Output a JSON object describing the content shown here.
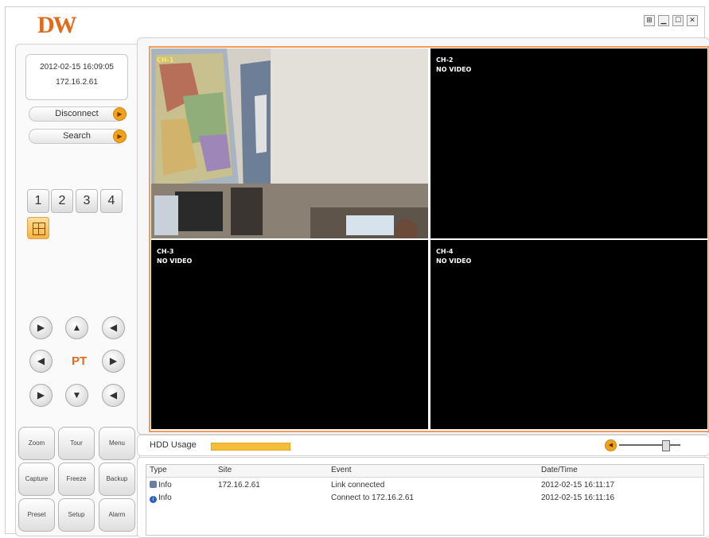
{
  "app": {
    "logo_text": "DW",
    "window_buttons": [
      {
        "name": "compact",
        "glyph": "⊞"
      },
      {
        "name": "minimize",
        "glyph": "▁"
      },
      {
        "name": "maximize",
        "glyph": "☐"
      },
      {
        "name": "close",
        "glyph": "✕"
      }
    ]
  },
  "status": {
    "datetime": "2012-02-15 16:09:05",
    "ip": "172.16.2.61"
  },
  "buttons": {
    "disconnect": "Disconnect",
    "search": "Search"
  },
  "channel_buttons": [
    "1",
    "2",
    "3",
    "4"
  ],
  "ptz": {
    "label": "PT",
    "icons": {
      "up_left": "▶",
      "up": "▲",
      "up_right": "◀",
      "left": "◀",
      "right": "▶",
      "down_left": "▶",
      "down": "▼",
      "down_right": "◀"
    }
  },
  "function_buttons": [
    {
      "id": "zoom",
      "label": "Zoom"
    },
    {
      "id": "tour",
      "label": "Tour"
    },
    {
      "id": "menu",
      "label": "Menu"
    },
    {
      "id": "capture",
      "label": "Capture"
    },
    {
      "id": "freeze",
      "label": "Freeze"
    },
    {
      "id": "backup",
      "label": "Backup"
    },
    {
      "id": "preset",
      "label": "Preset"
    },
    {
      "id": "setup",
      "label": "Setup"
    },
    {
      "id": "alarm",
      "label": "Alarm"
    }
  ],
  "channels": [
    {
      "label": "CH-1",
      "status": "",
      "selected": true
    },
    {
      "label": "CH-2",
      "status": "NO VIDEO",
      "selected": false
    },
    {
      "label": "CH-3",
      "status": "NO VIDEO",
      "selected": false
    },
    {
      "label": "CH-4",
      "status": "NO VIDEO",
      "selected": false
    }
  ],
  "hdd": {
    "label": "HDD Usage",
    "usage_fraction": 1.0,
    "bar_color": "#f5be3a"
  },
  "volume": {
    "level_fraction": 0.75
  },
  "event_log": {
    "columns": [
      "Type",
      "Site",
      "Event",
      "Date/Time"
    ],
    "rows": [
      {
        "type": "Info",
        "site": "172.16.2.61",
        "event": "Link connected",
        "datetime": "2012-02-15 16:11:17"
      },
      {
        "type": "Info",
        "site": "",
        "event": "Connect to 172.16.2.61",
        "datetime": "2012-02-15 16:11:16"
      }
    ]
  },
  "colors": {
    "accent_orange": "#f0a21c",
    "logo_orange": "#e26a1b",
    "selected_tile_border": "#d8262a",
    "grid_border": "#f29a5b"
  }
}
